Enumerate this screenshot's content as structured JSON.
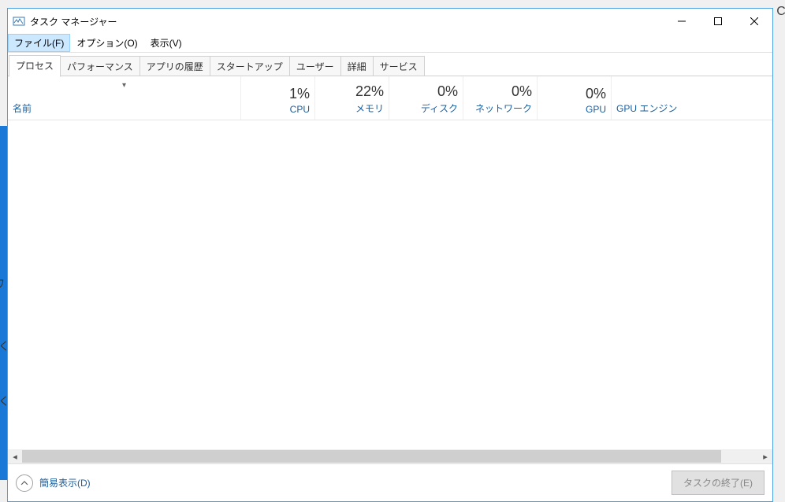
{
  "window": {
    "title": "タスク マネージャー"
  },
  "menu": {
    "file": "ファイル(F)",
    "options": "オプション(O)",
    "view": "表示(V)"
  },
  "tabs": {
    "processes": "プロセス",
    "performance": "パフォーマンス",
    "app_history": "アプリの履歴",
    "startup": "スタートアップ",
    "users": "ユーザー",
    "details": "詳細",
    "services": "サービス"
  },
  "columns": {
    "name": "名前",
    "cpu": {
      "value": "1%",
      "label": "CPU"
    },
    "memory": {
      "value": "22%",
      "label": "メモリ"
    },
    "disk": {
      "value": "0%",
      "label": "ディスク"
    },
    "network": {
      "value": "0%",
      "label": "ネットワーク"
    },
    "gpu": {
      "value": "0%",
      "label": "GPU"
    },
    "gpu_engine": {
      "label": "GPU エンジン"
    }
  },
  "bottom": {
    "fewer_details": "簡易表示(D)",
    "end_task": "タスクの終了(E)"
  }
}
